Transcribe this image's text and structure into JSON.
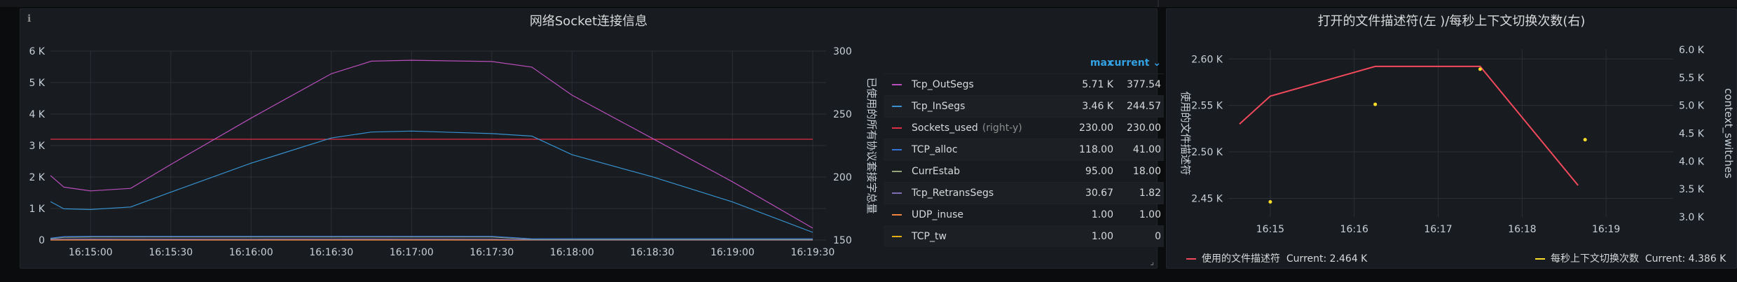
{
  "panel1": {
    "title": "网络Socket连接信息",
    "info_icon": "info-icon",
    "y_left_ticks": [
      "6 K",
      "5 K",
      "4 K",
      "3 K",
      "2 K",
      "1 K",
      "0"
    ],
    "y_right_ticks": [
      "300",
      "250",
      "200",
      "150"
    ],
    "y_right_label": "已使用的所有协议套接字总量",
    "x_ticks": [
      "16:15:00",
      "16:15:30",
      "16:16:00",
      "16:16:30",
      "16:17:00",
      "16:17:30",
      "16:18:00",
      "16:18:30",
      "16:19:00",
      "16:19:30"
    ],
    "legend_header": {
      "max": "max",
      "current": "current"
    },
    "legend": [
      {
        "name": "Tcp_OutSegs",
        "suffix": "",
        "max": "5.71 K",
        "current": "377.54",
        "color": "#b84ebb"
      },
      {
        "name": "Tcp_InSegs",
        "suffix": "",
        "max": "3.46 K",
        "current": "244.57",
        "color": "#3691cf"
      },
      {
        "name": "Sockets_used",
        "suffix": "(right-y)",
        "max": "230.00",
        "current": "230.00",
        "color": "#e02f44"
      },
      {
        "name": "TCP_alloc",
        "suffix": "",
        "max": "118.00",
        "current": "41.00",
        "color": "#3274d9"
      },
      {
        "name": "CurrEstab",
        "suffix": "",
        "max": "95.00",
        "current": "18.00",
        "color": "#96a37a"
      },
      {
        "name": "Tcp_RetransSegs",
        "suffix": "",
        "max": "30.67",
        "current": "1.82",
        "color": "#806eb7"
      },
      {
        "name": "UDP_inuse",
        "suffix": "",
        "max": "1.00",
        "current": "1.00",
        "color": "#ef843c"
      },
      {
        "name": "TCP_tw",
        "suffix": "",
        "max": "1.00",
        "current": "0",
        "color": "#e5ac0e"
      }
    ]
  },
  "panel2": {
    "title": "打开的文件描述符(左 )/每秒上下文切换次数(右)",
    "y_left_ticks": [
      "2.60 K",
      "2.55 K",
      "2.50 K",
      "2.45 K"
    ],
    "y_right_ticks": [
      "6.0 K",
      "5.5 K",
      "5.0 K",
      "4.5 K",
      "4.0 K",
      "3.5 K",
      "3.0 K"
    ],
    "y_left_label": "使用的文件描述符",
    "y_right_label": "context_switches",
    "x_ticks": [
      "16:15",
      "16:16",
      "16:17",
      "16:18",
      "16:19"
    ],
    "legend": [
      {
        "name": "使用的文件描述符",
        "current": "Current: 2.464 K",
        "color": "#f2495c"
      },
      {
        "name": "每秒上下文切换次数",
        "current": "Current: 4.386 K",
        "color": "#fade2a"
      }
    ]
  },
  "chart_data": [
    {
      "type": "line",
      "title": "网络Socket连接信息",
      "ylabel_right": "已使用的所有协议套接字总量",
      "ylim": [
        0,
        6000
      ],
      "ylim_right": [
        150,
        300
      ],
      "x": [
        "16:14:45",
        "16:14:50",
        "16:15:00",
        "16:15:15",
        "16:15:30",
        "16:16:00",
        "16:16:30",
        "16:16:45",
        "16:17:00",
        "16:17:30",
        "16:17:45",
        "16:18:00",
        "16:18:30",
        "16:19:00",
        "16:19:30"
      ],
      "series": [
        {
          "name": "Tcp_OutSegs",
          "values": [
            2050,
            1680,
            1560,
            1640,
            2400,
            3870,
            5280,
            5680,
            5710,
            5670,
            5490,
            4600,
            3230,
            1850,
            377.54
          ]
        },
        {
          "name": "Tcp_InSegs",
          "values": [
            1220,
            990,
            970,
            1050,
            1520,
            2440,
            3240,
            3430,
            3460,
            3380,
            3300,
            2710,
            2010,
            1210,
            244.57
          ]
        },
        {
          "name": "Sockets_used",
          "axis": "right",
          "values": [
            230,
            230,
            230,
            230,
            230,
            230,
            230,
            230,
            230,
            230,
            230,
            230,
            230,
            230,
            230
          ]
        },
        {
          "name": "TCP_alloc",
          "values": [
            60,
            110,
            118,
            118,
            118,
            118,
            118,
            118,
            118,
            118,
            41,
            41,
            41,
            41,
            41
          ]
        },
        {
          "name": "CurrEstab",
          "values": [
            40,
            85,
            95,
            95,
            95,
            95,
            95,
            95,
            95,
            95,
            18,
            18,
            18,
            18,
            18
          ]
        },
        {
          "name": "Tcp_RetransSegs",
          "values": [
            20,
            28,
            30.67,
            28,
            25,
            27,
            29,
            30,
            28,
            27,
            5,
            3,
            2,
            2,
            1.82
          ]
        },
        {
          "name": "UDP_inuse",
          "values": [
            1,
            1,
            1,
            1,
            1,
            1,
            1,
            1,
            1,
            1,
            1,
            1,
            1,
            1,
            1
          ]
        },
        {
          "name": "TCP_tw",
          "values": [
            1,
            1,
            1,
            1,
            1,
            1,
            1,
            1,
            1,
            1,
            0,
            0,
            0,
            0,
            0
          ]
        }
      ]
    },
    {
      "type": "line",
      "title": "打开的文件描述符(左 )/每秒上下文切换次数(右)",
      "ylabel": "使用的文件描述符",
      "ylabel_right": "context_switches",
      "ylim": [
        2430,
        2610
      ],
      "ylim_right": [
        3000,
        6000
      ],
      "series": [
        {
          "name": "使用的文件描述符",
          "x": [
            "16:14:38",
            "16:15:00",
            "16:16:15",
            "16:17:30",
            "16:18:40"
          ],
          "values": [
            2530,
            2560,
            2592,
            2592,
            2464
          ]
        },
        {
          "name": "每秒上下文切换次数",
          "type": "scatter",
          "axis": "right",
          "x": [
            "16:15:00",
            "16:16:15",
            "16:17:30",
            "16:18:45"
          ],
          "values": [
            3270,
            5020,
            5650,
            4386
          ]
        }
      ]
    }
  ]
}
